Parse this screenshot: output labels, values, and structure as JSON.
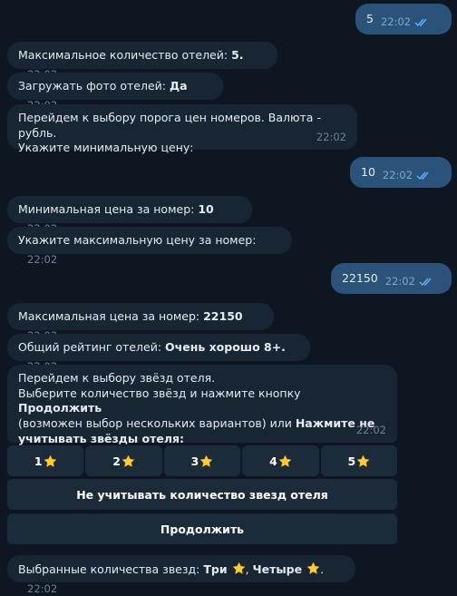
{
  "messages": [
    {
      "id": "m1",
      "dir": "out",
      "text": "5",
      "time": "22:02"
    },
    {
      "id": "m2",
      "dir": "in",
      "pre": "Максимальное количество отелей: ",
      "bold": "5.",
      "post": "",
      "time": "22:02"
    },
    {
      "id": "m3",
      "dir": "in",
      "pre": "Загружать фото отелей: ",
      "bold": "Да",
      "post": "",
      "time": "22:02"
    },
    {
      "id": "m4",
      "dir": "in",
      "line1": "Перейдем к выбору порога цен номеров. Валюта - рубль.",
      "line2": "Укажите минимальную цену:",
      "time": "22:02"
    },
    {
      "id": "m5",
      "dir": "out",
      "text": "10",
      "time": "22:02"
    },
    {
      "id": "m6",
      "dir": "in",
      "pre": "Минимальная цена за номер: ",
      "bold": "10",
      "post": "",
      "time": "22:02"
    },
    {
      "id": "m7",
      "dir": "in",
      "pre": "Укажите максимальную цену за номер:",
      "bold": "",
      "post": "",
      "time": "22:02"
    },
    {
      "id": "m8",
      "dir": "out",
      "text": "22150",
      "time": "22:02"
    },
    {
      "id": "m9",
      "dir": "in",
      "pre": "Максимальная цена за номер: ",
      "bold": "22150",
      "post": "",
      "time": "22:02"
    },
    {
      "id": "m10",
      "dir": "in",
      "pre": "Общий рейтинг отелей: ",
      "bold": "Очень хорошо 8+.",
      "post": "",
      "time": "22:02"
    },
    {
      "id": "m11",
      "dir": "in",
      "line1": "Перейдем к выбору звёзд отеля.",
      "line2_pre": "Выберите количество звёзд и нажмите кнопку ",
      "line2_bold": "Продолжить",
      "line3_pre": "(возможен выбор нескольких вариантов) или ",
      "line3_bold": "Нажмите не",
      "line4_bold": "учитывать звёзды отеля:",
      "time": "22:02"
    },
    {
      "id": "m12",
      "dir": "in",
      "pre": "Выбранные количества звезд: ",
      "bold1": "Три",
      "mid": ", ",
      "bold2": "Четыре",
      "end": ".",
      "time": "22:02"
    }
  ],
  "keyboard": {
    "star_buttons": [
      "1",
      "2",
      "3",
      "4",
      "5"
    ],
    "star_icon": "star-emoji",
    "ignore_label": "Не учитывать количество звезд отеля",
    "continue_label": "Продолжить"
  },
  "colors": {
    "background": "#0e1621",
    "incoming": "#182533",
    "outgoing": "#2b5278",
    "button": "#1c2b3a",
    "read_check": "#5fb3ff"
  }
}
